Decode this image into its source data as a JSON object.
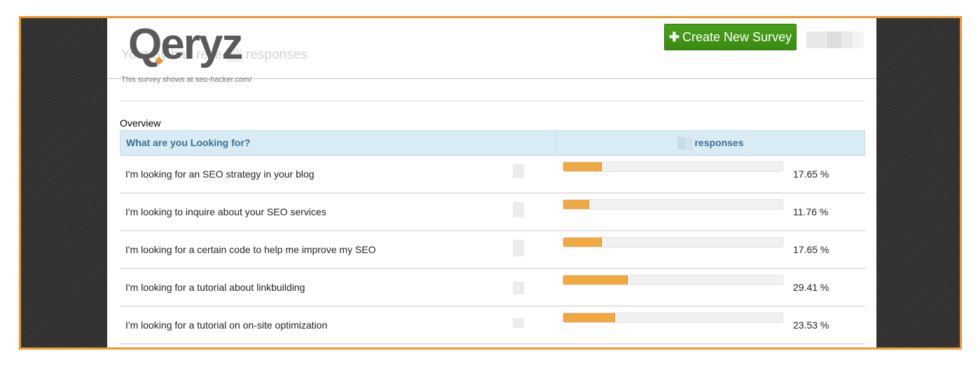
{
  "header": {
    "logo_text": "Qeryz",
    "bg_heading_start": "Your S",
    "bg_heading_mid": "y has rece",
    "bg_heading_end": "responses",
    "subtitle": "This survey shows at seo-hacker.com/",
    "create_button_label": "Create New Survey"
  },
  "overview": {
    "label": "Overview",
    "question_header": "What are you Looking for?",
    "responses_header": "responses"
  },
  "rows": [
    {
      "label": "I'm looking for an SEO strategy in your blog",
      "percent": 17.65,
      "percent_text": "17.65 %"
    },
    {
      "label": "I'm looking to inquire about your SEO services",
      "percent": 11.76,
      "percent_text": "11.76 %"
    },
    {
      "label": "I'm looking for a certain code to help me improve my SEO",
      "percent": 17.65,
      "percent_text": "17.65 %"
    },
    {
      "label": "I'm looking for a tutorial about linkbuilding",
      "percent": 29.41,
      "percent_text": "29.41 %"
    },
    {
      "label": "I'm looking for a tutorial on on-site optimization",
      "percent": 23.53,
      "percent_text": "23.53 %"
    }
  ],
  "colors": {
    "frame_border": "#f0962e",
    "button_green": "#3b8a12",
    "bar_orange": "#f0a843",
    "header_blue_bg": "#d9ecf6",
    "header_blue_text": "#3a6f96",
    "logo_dark": "#5a5a5a",
    "logo_accent": "#f0962e"
  }
}
